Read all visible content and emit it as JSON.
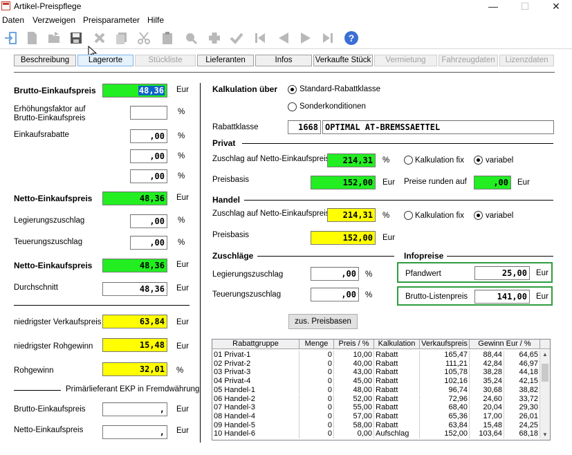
{
  "window": {
    "title": "Artikel-Preispflege",
    "minimize": "—",
    "maximize": "☐",
    "close": "✕"
  },
  "menu": [
    "Daten",
    "Verzweigen",
    "Preisparameter",
    "Hilfe"
  ],
  "tabs": [
    "Beschreibung",
    "Lagerorte",
    "Stückliste",
    "Lieferanten",
    "Infos",
    "Verkaufte Stück",
    "Vermietung",
    "Fahrzeugdaten",
    "Lizenzdaten"
  ],
  "left": {
    "brutto_ek_label": "Brutto-Einkaufspreis",
    "brutto_ek_value": "48,36",
    "brutto_ek_unit": "Eur",
    "erhoehung_label_1": "Erhöhungsfaktor auf",
    "erhoehung_label_2": "Brutto-Einkaufspreis",
    "erhoehung_value": "",
    "erhoehung_unit": "%",
    "rabatte_label": "Einkaufsrabatte",
    "rabatt_1": ",00",
    "rabatt_2": ",00",
    "rabatt_3": ",00",
    "rabatt_unit": "%",
    "netto_ek_label": "Netto-Einkaufspreis",
    "netto_ek_value": "48,36",
    "netto_ek_unit": "Eur",
    "legierung_label": "Legierungszuschlag",
    "legierung_value": ",00",
    "legierung_unit": "%",
    "teuerung_label": "Teuerungszuschlag",
    "teuerung_value": ",00",
    "teuerung_unit": "%",
    "netto_ek2_label": "Netto-Einkaufspreis",
    "netto_ek2_value": "48,36",
    "netto_ek2_unit": "Eur",
    "durchschnitt_label": "Durchschnitt",
    "durchschnitt_value": "48,36",
    "durchschnitt_unit": "Eur",
    "min_vk_label": "niedrigster Verkaufspreis",
    "min_vk_value": "63,84",
    "min_vk_unit": "Eur",
    "min_rg_label": "niedrigster Rohgewinn",
    "min_rg_value": "15,48",
    "min_rg_unit": "Eur",
    "rohgewinn_label": "Rohgewinn",
    "rohgewinn_value": "32,01",
    "rohgewinn_unit": "%",
    "primaer_label": "Primärlieferant EKP in Fremdwährung",
    "fw_brutto_label": "Brutto-Einkaufspreis",
    "fw_brutto_value": ",",
    "fw_brutto_unit": "Eur",
    "fw_netto_label": "Netto-Einkaufspreis",
    "fw_netto_value": ",",
    "fw_netto_unit": "Eur"
  },
  "right": {
    "kalk_label": "Kalkulation über",
    "radio_standard": "Standard-Rabattklasse",
    "radio_sonder": "Sonderkonditionen",
    "rabattklasse_label": "Rabattklasse",
    "rabattklasse_nr": "1668",
    "rabattklasse_name": "OPTIMAL AT-BREMSSAETTEL",
    "privat_heading": "Privat",
    "privat_zuschlag_label": "Zuschlag auf Netto-Einkaufspreis",
    "privat_zuschlag_value": "214,31",
    "privat_zuschlag_unit": "%",
    "kalk_fix": "Kalkulation  fix",
    "variabel": "variabel",
    "privat_preisbasis_label": "Preisbasis",
    "privat_preisbasis_value": "152,00",
    "privat_preisbasis_unit": "Eur",
    "runden_label": "Preise runden auf",
    "runden_value": ",00",
    "runden_unit": "Eur",
    "handel_heading": "Handel",
    "handel_zuschlag_label": "Zuschlag auf Netto-Einkaufspreis",
    "handel_zuschlag_value": "214,31",
    "handel_zuschlag_unit": "%",
    "handel_preisbasis_label": "Preisbasis",
    "handel_preisbasis_value": "152,00",
    "handel_preisbasis_unit": "Eur",
    "zuschlaege_heading": "Zuschläge",
    "infopreise_heading": "Infopreise",
    "z_legierung_label": "Legierungszuschlag",
    "z_legierung_value": ",00",
    "z_legierung_unit": "%",
    "z_teuerung_label": "Teuerungszuschlag",
    "z_teuerung_value": ",00",
    "z_teuerung_unit": "%",
    "pfandwert_label": "Pfandwert",
    "pfandwert_value": "25,00",
    "pfandwert_unit": "Eur",
    "listenpreis_label": "Brutto-Listenpreis",
    "listenpreis_value": "141,00",
    "listenpreis_unit": "Eur",
    "preisbasen_button": "zus. Preisbasen"
  },
  "grid": {
    "columns": [
      "Rabattgruppe",
      "Menge",
      "Preis / %",
      "Kalkulation",
      "Verkaufspreis",
      "Gewinn Eur  /  %"
    ],
    "rows": [
      [
        "01 Privat-1",
        "0",
        "10,00",
        "Rabatt",
        "165,47",
        "88,44",
        "64,65"
      ],
      [
        "02 Privat-2",
        "0",
        "40,00",
        "Rabatt",
        "111,21",
        "42,84",
        "46,97"
      ],
      [
        "03 Privat-3",
        "0",
        "43,00",
        "Rabatt",
        "105,78",
        "38,28",
        "44,18"
      ],
      [
        "04 Privat-4",
        "0",
        "45,00",
        "Rabatt",
        "102,16",
        "35,24",
        "42,15"
      ],
      [
        "05 Handel-1",
        "0",
        "48,00",
        "Rabatt",
        "96,74",
        "30,68",
        "38,82"
      ],
      [
        "06 Handel-2",
        "0",
        "52,00",
        "Rabatt",
        "72,96",
        "24,60",
        "33,72"
      ],
      [
        "07 Handel-3",
        "0",
        "55,00",
        "Rabatt",
        "68,40",
        "20,04",
        "29,30"
      ],
      [
        "08 Handel-4",
        "0",
        "57,00",
        "Rabatt",
        "65,36",
        "17,00",
        "26,01"
      ],
      [
        "09 Handel-5",
        "0",
        "58,00",
        "Rabatt",
        "63,84",
        "15,48",
        "24,25"
      ],
      [
        "10 Handel-6",
        "0",
        "0,00",
        "Aufschlag",
        "152,00",
        "103,64",
        "68,18"
      ]
    ]
  },
  "icons": [
    "exit-icon",
    "new-icon",
    "open-icon",
    "save-icon",
    "delete-icon",
    "copy-icon",
    "cut-icon",
    "paste-icon",
    "search-icon",
    "add-icon",
    "check-icon",
    "first-icon",
    "prev-icon",
    "next-icon",
    "last-icon",
    "help-icon"
  ],
  "colors": {
    "green_field": "#22ee22",
    "yellow_field": "#ffff00",
    "info_border": "#2e9b3e",
    "help_blue": "#3b6fd6"
  }
}
